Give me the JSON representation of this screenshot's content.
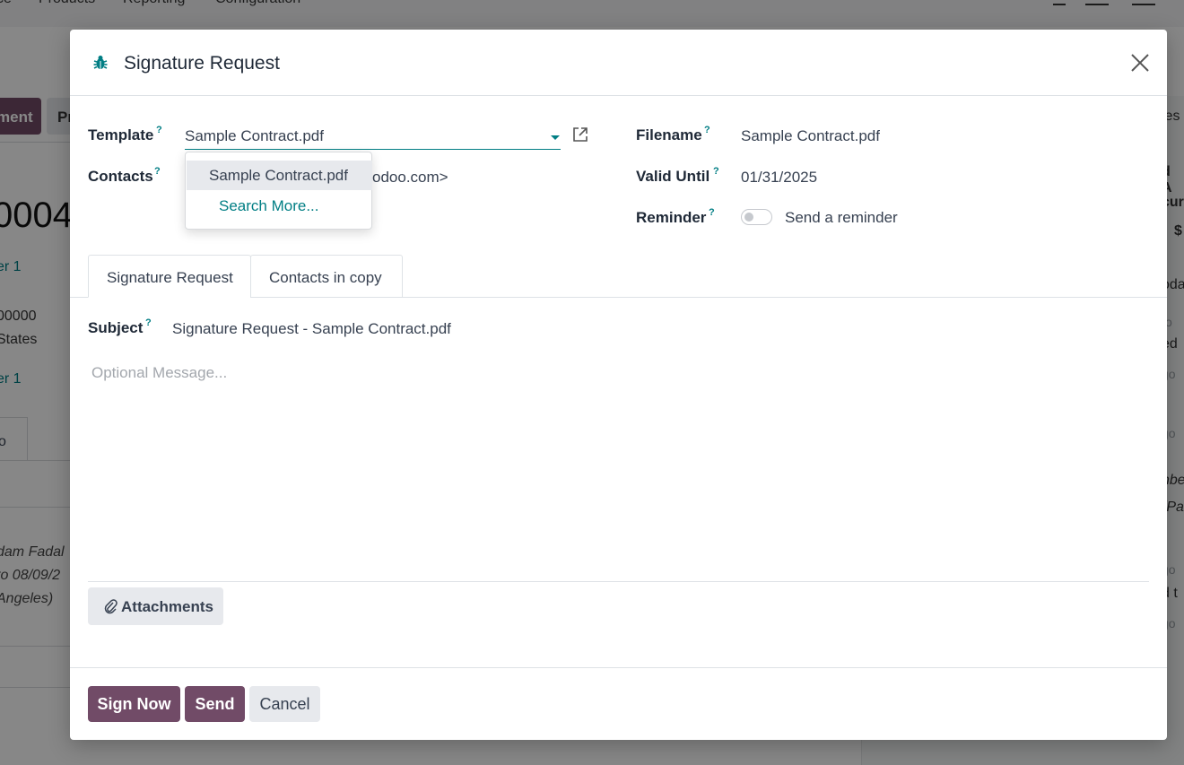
{
  "background": {
    "topnav": [
      "ce",
      "Products",
      "Reporting",
      "Configuration"
    ],
    "primary_button": "ment",
    "secondary_button": "Pr",
    "record_number": "0004",
    "link_1": "er 1",
    "address_1": "00000",
    "address_2": "States",
    "link_2": "er 1",
    "tab_fragment": "o",
    "italic_1": "dam Fadal",
    "italic_2": "to 08/09/2",
    "italic_3": "Angeles)",
    "right_panel": [
      "ies",
      "d A",
      "cur",
      "$",
      "oda",
      "o",
      "ed",
      "go",
      "go",
      "nbe",
      "(Pa",
      "go",
      "d t",
      "go"
    ]
  },
  "modal": {
    "title": "Signature Request",
    "labels": {
      "template": "Template",
      "contacts": "Contacts",
      "filename": "Filename",
      "valid_until": "Valid Until",
      "reminder": "Reminder",
      "subject": "Subject",
      "help_mark": "?"
    },
    "template_value": "Sample Contract.pdf",
    "contacts_partial": "odoo.com>",
    "filename_value": "Sample Contract.pdf",
    "valid_until_value": "01/31/2025",
    "reminder_label": "Send a reminder",
    "reminder_enabled": false,
    "dropdown": {
      "option": "Sample Contract.pdf",
      "search_more": "Search More..."
    },
    "tabs": [
      "Signature Request",
      "Contacts in copy"
    ],
    "subject_value": "Signature Request - Sample Contract.pdf",
    "message_placeholder": "Optional Message...",
    "attachments_label": "Attachments",
    "buttons": {
      "sign_now": "Sign Now",
      "send": "Send",
      "cancel": "Cancel"
    },
    "colors": {
      "primary": "#714b67",
      "accent": "#017e84"
    }
  }
}
